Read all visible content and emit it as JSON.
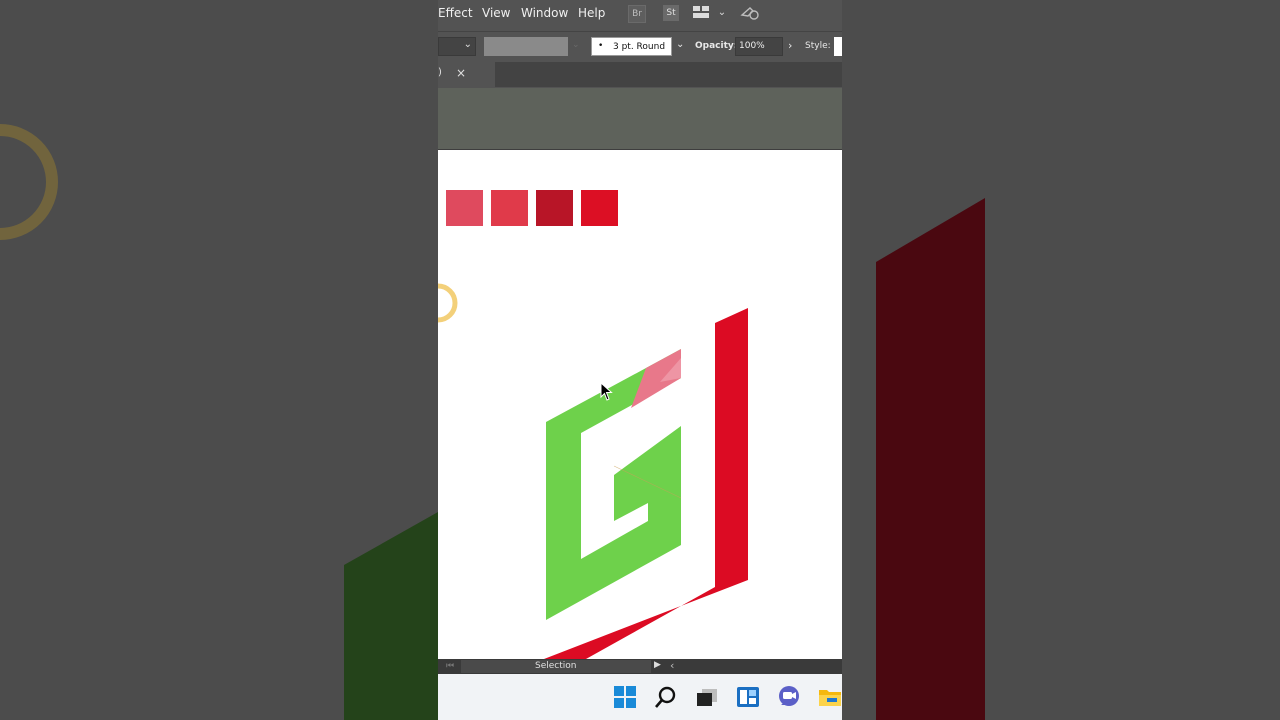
{
  "menubar": {
    "items": [
      "Effect",
      "View",
      "Window",
      "Help"
    ],
    "icons": [
      "bridge-icon",
      "stock-icon",
      "workspace-switcher-icon",
      "chevron-down-icon",
      "search-sync-icon"
    ],
    "bridge_label": "Br",
    "stock_label": "St"
  },
  "controlbar": {
    "stroke_profile": "3 pt. Round",
    "opacity_label": "Opacity:",
    "opacity_value": "100%",
    "style_label": "Style:"
  },
  "tabbar": {
    "tab_fragment": ")",
    "close_glyph": "×"
  },
  "artboard": {
    "swatches": [
      "#df4a5e",
      "#e03a4a",
      "#b81527",
      "#dc0f24"
    ],
    "logo_colors": {
      "green": "#6ed14b",
      "red": "#dc0b23",
      "pink": "#e8788a"
    }
  },
  "statusbar": {
    "tool_name": "Selection"
  },
  "taskbar": {
    "icons": [
      "windows-start-icon",
      "search-icon",
      "task-view-icon",
      "widgets-icon",
      "teams-chat-icon",
      "file-explorer-icon"
    ]
  }
}
